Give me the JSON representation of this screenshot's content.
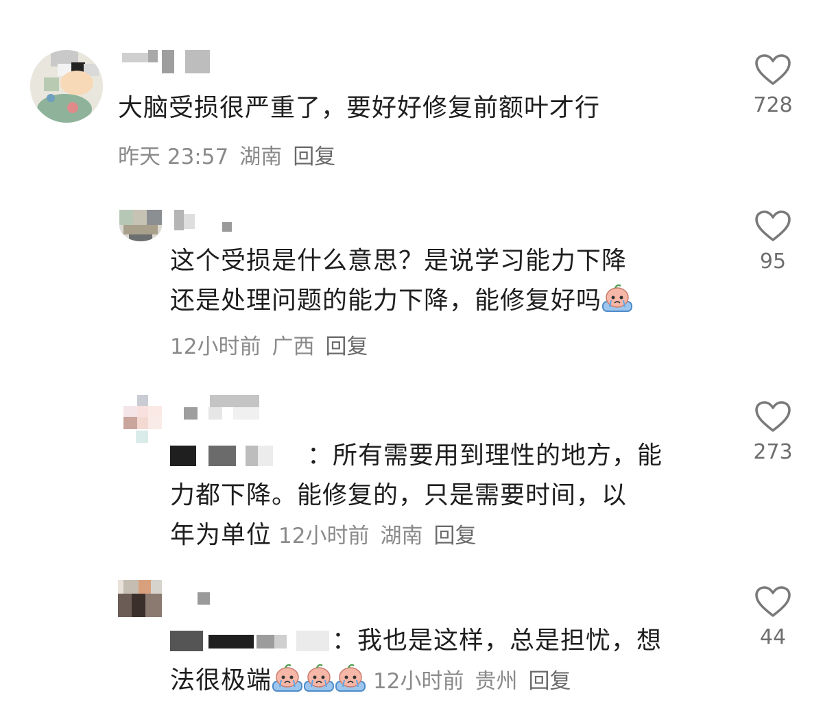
{
  "comments": [
    {
      "text": "大脑受损很严重了，要好好修复前额叶才行",
      "time": "昨天 23:57",
      "location": "湖南",
      "reply_label": "回复",
      "likes": "728"
    },
    {
      "text_line1": "这个受损是什么意思？是说学习能力下降",
      "text_line2": "还是处理问题的能力下降，能修复好吗",
      "time": "12小时前",
      "location": "广西",
      "reply_label": "回复",
      "likes": "95"
    },
    {
      "colon": "：",
      "text_line1": "所有需要用到理性的地方，能",
      "text_line2": "力都下降。能修复的，只是需要时间，以",
      "text_line3": "年为单位",
      "time": "12小时前",
      "location": "湖南",
      "reply_label": "回复",
      "likes": "273"
    },
    {
      "colon": "：",
      "text_line1": "我也是这样，总是担忧，想",
      "text_line2": "法很极端",
      "time": "12小时前",
      "location": "贵州",
      "reply_label": "回复",
      "likes": "44"
    }
  ],
  "icons": {
    "like": "heart-outline-icon",
    "emoji": "crying-peach-emoji"
  },
  "colors": {
    "text": "#1e1e1e",
    "meta": "#8a8a8a",
    "icon": "#7a7a7a"
  }
}
